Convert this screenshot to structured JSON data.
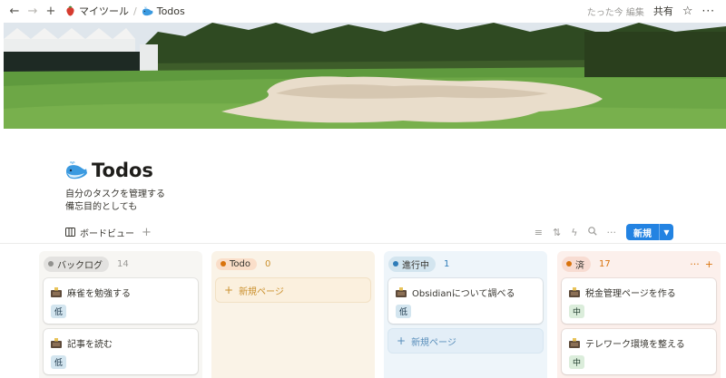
{
  "topbar": {
    "breadcrumbs": [
      {
        "label": "マイツール",
        "icon": "red-strawberry-icon"
      },
      {
        "label": "Todos",
        "icon": "whale-icon"
      }
    ],
    "separator": "/",
    "edited": "たった今 編集",
    "share": "共有"
  },
  "page": {
    "icon": "whale-icon",
    "title": "Todos",
    "description": [
      "自分のタスクを管理する",
      "備忘目的としても"
    ]
  },
  "views": {
    "active_tab": "ボードビュー",
    "new_button": "新規"
  },
  "colors": {
    "accent": "#2383e2",
    "backlog_bg": "#f7f6f3",
    "todo_bg": "#faf3e7",
    "doing_bg": "#eef5fa",
    "done_bg": "#fcf0ec"
  },
  "board": {
    "columns": [
      {
        "name": "バックログ",
        "count": "14",
        "cards": [
          {
            "title": "麻雀を勉強する",
            "tag": "低"
          },
          {
            "title": "記事を読む",
            "tag": "低"
          }
        ]
      },
      {
        "name": "Todo",
        "count": "0",
        "cards": [],
        "new_page": "新規ページ"
      },
      {
        "name": "進行中",
        "count": "1",
        "cards": [
          {
            "title": "Obsidianについて調べる",
            "tag": "低"
          }
        ],
        "new_page": "新規ページ"
      },
      {
        "name": "済",
        "count": "17",
        "cards": [
          {
            "title": "税金管理ページを作る",
            "tag": "中"
          },
          {
            "title": "テレワーク環境を整える",
            "tag": "中"
          }
        ]
      }
    ]
  }
}
